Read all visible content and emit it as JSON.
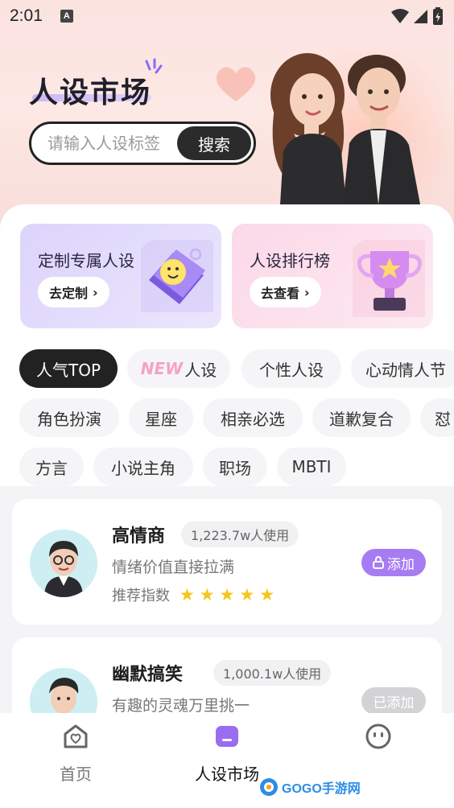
{
  "status_bar": {
    "time": "2:01",
    "notification_icon": "A"
  },
  "hero": {
    "title": "人设市场"
  },
  "search": {
    "placeholder": "请输入人设标签",
    "button_label": "搜索"
  },
  "banners": [
    {
      "title": "定制专属人设",
      "button_label": "去定制",
      "color": "#dcd4fb"
    },
    {
      "title": "人设排行榜",
      "button_label": "去查看",
      "color": "#fbd8e8"
    }
  ],
  "tags": {
    "row1": [
      "人气TOP",
      "人设",
      "个性人设",
      "心动情人节"
    ],
    "new_badge": "NEW",
    "row2": [
      "角色扮演",
      "星座",
      "相亲必选",
      "道歉复合",
      "怼"
    ],
    "row3": [
      "方言",
      "小说主角",
      "职场",
      "MBTI"
    ]
  },
  "cards": [
    {
      "name": "高情商",
      "usage": "1,223.7w人使用",
      "desc": "情绪价值直接拉满",
      "rec_label": "推荐指数",
      "stars": 5,
      "button": "添加",
      "locked": true
    },
    {
      "name": "幽默搞笑",
      "usage": "1,000.1w人使用",
      "desc": "有趣的灵魂万里挑一",
      "button": "已添加",
      "locked": false
    }
  ],
  "tabbar": {
    "items": [
      {
        "label": "首页"
      },
      {
        "label": "人设市场"
      },
      {
        "label": ""
      }
    ]
  },
  "watermark": {
    "text": "GOGO手游网"
  },
  "colors": {
    "accent": "#a77cf2",
    "dark": "#222222",
    "star": "#f5c518"
  }
}
